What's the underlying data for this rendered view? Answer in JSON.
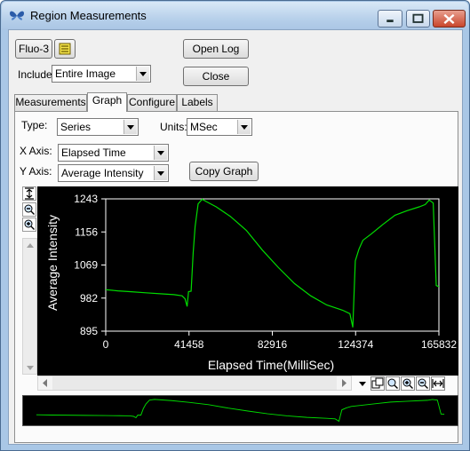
{
  "window": {
    "title": "Region Measurements",
    "accent": "#a9c7e6"
  },
  "controls": {
    "channel_button": "Fluo-3",
    "open_log": "Open Log",
    "close": "Close",
    "include_label": "Include",
    "include_value": "Entire Image"
  },
  "tabs": [
    {
      "label": "Measurements",
      "active": false
    },
    {
      "label": "Graph",
      "active": true
    },
    {
      "label": "Configure",
      "active": false
    },
    {
      "label": "Labels",
      "active": false
    }
  ],
  "graph_tab": {
    "type_label": "Type:",
    "type_value": "Series",
    "units_label": "Units:",
    "units_value": "MSec",
    "xaxis_label": "X Axis:",
    "xaxis_value": "Elapsed Time",
    "yaxis_label": "Y Axis:",
    "yaxis_value": "Average Intensity",
    "copy_graph": "Copy Graph"
  },
  "icons": {
    "app": "butterfly-icon",
    "layers": "layers-icon",
    "fit": "fit-vertical-icon",
    "zoom_out": "zoom-out-icon",
    "zoom_in": "zoom-in-icon"
  },
  "chart_data": {
    "type": "line",
    "xlabel": "Elapsed Time(MilliSec)",
    "ylabel": "Average Intensity",
    "x_ticks": [
      "0",
      "41458",
      "82916",
      "124374",
      "165832"
    ],
    "y_ticks": [
      "895",
      "982",
      "1069",
      "1156",
      "1243"
    ],
    "xlim": [
      0,
      165832
    ],
    "ylim": [
      895,
      1243
    ],
    "line_color": "#00dd00",
    "series": [
      {
        "points": [
          [
            0,
            1004
          ],
          [
            6000,
            1001
          ],
          [
            12000,
            999
          ],
          [
            20000,
            996
          ],
          [
            28000,
            993
          ],
          [
            34000,
            991
          ],
          [
            38000,
            988
          ],
          [
            39500,
            980
          ],
          [
            40500,
            960
          ],
          [
            41200,
            999
          ],
          [
            42500,
            1000
          ],
          [
            43500,
            1100
          ],
          [
            44500,
            1170
          ],
          [
            46000,
            1230
          ],
          [
            48000,
            1242
          ],
          [
            50000,
            1236
          ],
          [
            55000,
            1222
          ],
          [
            62000,
            1197
          ],
          [
            70000,
            1160
          ],
          [
            78000,
            1108
          ],
          [
            86000,
            1062
          ],
          [
            94000,
            1020
          ],
          [
            102000,
            988
          ],
          [
            110000,
            964
          ],
          [
            118000,
            950
          ],
          [
            121500,
            941
          ],
          [
            123000,
            905
          ],
          [
            124200,
            1080
          ],
          [
            126000,
            1110
          ],
          [
            128000,
            1134
          ],
          [
            132000,
            1150
          ],
          [
            138000,
            1176
          ],
          [
            144000,
            1200
          ],
          [
            150000,
            1212
          ],
          [
            156000,
            1222
          ],
          [
            159000,
            1228
          ],
          [
            161000,
            1240
          ],
          [
            163000,
            1232
          ],
          [
            164500,
            1015
          ],
          [
            165832,
            1012
          ]
        ]
      }
    ]
  }
}
